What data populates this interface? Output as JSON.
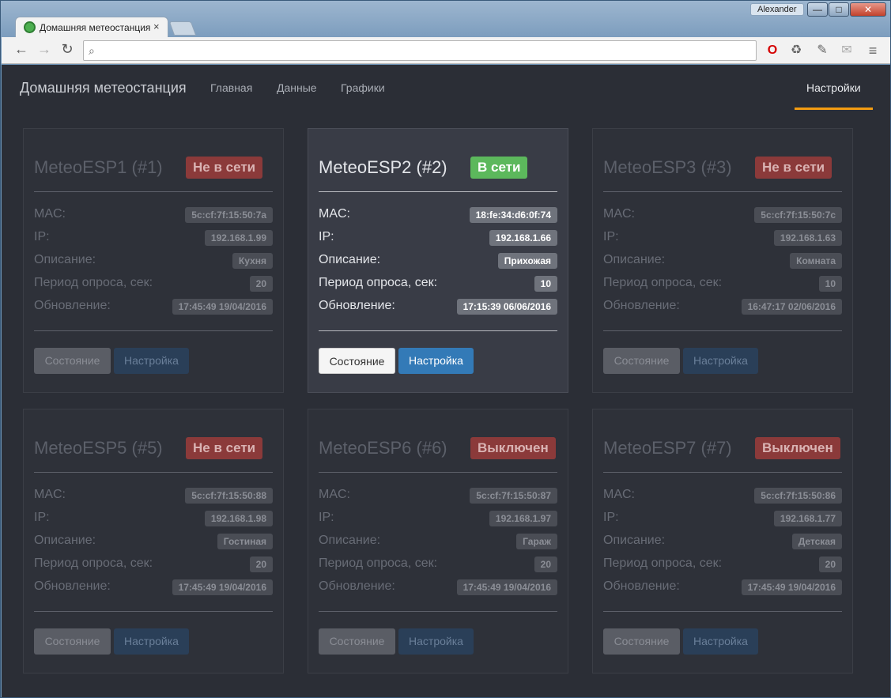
{
  "window": {
    "user": "Alexander",
    "minimize": "—",
    "maximize": "□",
    "close": "✕"
  },
  "browser": {
    "tab_title": "Домашняя метеостанция",
    "tab_close": "×",
    "back": "←",
    "forward": "→",
    "reload": "↻",
    "search_icon": "⌕",
    "address_value": "",
    "extensions": [
      "opera-icon",
      "recycle-icon",
      "eyedropper-icon",
      "mail-icon",
      "menu-icon"
    ]
  },
  "navbar": {
    "brand": "Домашняя метеостанция",
    "links": [
      "Главная",
      "Данные",
      "Графики"
    ],
    "settings": "Настройки"
  },
  "labels": {
    "mac": "MAC:",
    "ip": "IP:",
    "desc": "Описание:",
    "period": "Период опроса, сек:",
    "updated": "Обновление:",
    "state_btn": "Состояние",
    "config_btn": "Настройка"
  },
  "colors": {
    "online": "#5cb85c",
    "offline": "#8b3a3a",
    "accent": "#f39c12",
    "primary": "#337ab7"
  },
  "devices": [
    {
      "title": "MeteoESP1 (#1)",
      "status": "Не в сети",
      "online": false,
      "mac": "5c:cf:7f:15:50:7a",
      "ip": "192.168.1.99",
      "desc": "Кухня",
      "period": "20",
      "updated": "17:45:49 19/04/2016"
    },
    {
      "title": "MeteoESP2 (#2)",
      "status": "В сети",
      "online": true,
      "mac": "18:fe:34:d6:0f:74",
      "ip": "192.168.1.66",
      "desc": "Прихожая",
      "period": "10",
      "updated": "17:15:39 06/06/2016"
    },
    {
      "title": "MeteoESP3 (#3)",
      "status": "Не в сети",
      "online": false,
      "mac": "5c:cf:7f:15:50:7c",
      "ip": "192.168.1.63",
      "desc": "Комната",
      "period": "10",
      "updated": "16:47:17 02/06/2016"
    },
    {
      "title": "MeteoESP5 (#5)",
      "status": "Не в сети",
      "online": false,
      "mac": "5c:cf:7f:15:50:88",
      "ip": "192.168.1.98",
      "desc": "Гостиная",
      "period": "20",
      "updated": "17:45:49 19/04/2016"
    },
    {
      "title": "MeteoESP6 (#6)",
      "status": "Выключен",
      "online": false,
      "mac": "5c:cf:7f:15:50:87",
      "ip": "192.168.1.97",
      "desc": "Гараж",
      "period": "20",
      "updated": "17:45:49 19/04/2016"
    },
    {
      "title": "MeteoESP7 (#7)",
      "status": "Выключен",
      "online": false,
      "mac": "5c:cf:7f:15:50:86",
      "ip": "192.168.1.77",
      "desc": "Детская",
      "period": "20",
      "updated": "17:45:49 19/04/2016"
    }
  ]
}
